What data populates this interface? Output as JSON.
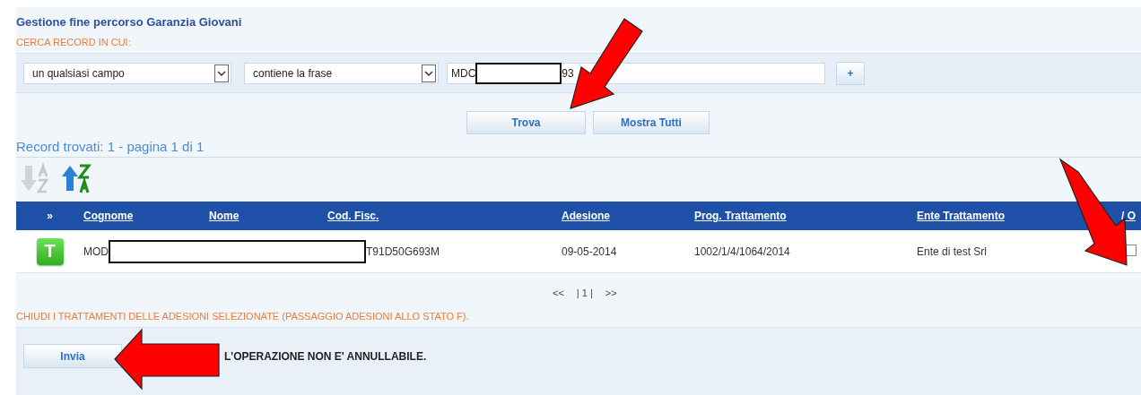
{
  "title": "Gestione fine percorso Garanzia Giovani",
  "search_label": "CERCA RECORD IN CUI:",
  "filters": [
    {
      "value": "un qualsiasi campo"
    },
    {
      "value": "contiene la frase"
    }
  ],
  "search_field": {
    "value_start": "MDC",
    "value_end": "93"
  },
  "add_button": "+",
  "buttons": [
    "Trova",
    "Mostra Tutti"
  ],
  "results_summary": "Record trovati: 1 - pagina 1 di 1",
  "sort_buttons": [
    {
      "disabled": true
    },
    {
      "disabled": false
    }
  ],
  "table": {
    "columns": [
      "»",
      "Cognome",
      "Nome",
      "Cod. Fisc.",
      "Adesione",
      "Prog. Trattamento",
      "Ente Trattamento",
      "/ O"
    ],
    "rows": [
      {
        "badge": "T",
        "cognome": "MOD",
        "cod_fisc": "T91D50G693M",
        "adesione": "09-05-2014",
        "prog_trattamento": "1002/1/4/1064/2014",
        "ente_trattamento": "Ente di test Srl",
        "checked": false
      }
    ]
  },
  "pagination": {
    "prev": "<<",
    "pages": "| 1 |",
    "next": ">>"
  },
  "action_label": "CHIUDI I TRATTAMENTI DELLE ADESIONI SELEZIONATE (PASSAGGIO ADESIONI ALLO STATO F).",
  "submit_button": "Invia",
  "warning": "L'OPERAZIONE NON E' ANNULLABILE."
}
